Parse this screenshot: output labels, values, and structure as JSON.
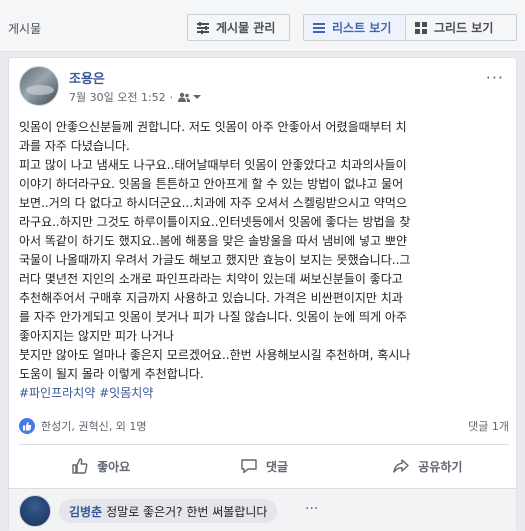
{
  "header": {
    "section_title": "게시물",
    "manage_label": "게시물 관리",
    "list_view_label": "리스트 보기",
    "grid_view_label": "그리드 보기"
  },
  "post": {
    "author": "조용은",
    "timestamp": "7월 30일 오전 1:52",
    "separator": "·",
    "lines": [
      "잇몸이 안좋으신분들께 권합니다. 저도 잇몸이 아주 안좋아서 어렸을때부터 치",
      "과를 자주 다녔습니다.",
      "피고 많이 나고 냄새도 나구요..태어날때부터 잇몸이 안좋았다고 치과의사들이",
      "이야기 하더라구요. 잇몸을 튼튼하고 안아프게 할 수 있는 방법이 없냐고 물어",
      "보면..거의 다 없다고 하시더군요...치과에 자주 오셔서 스켈링받으시고 약먹으",
      "라구요..하지만 그것도 하루이틀이지요..인터넷등에서 잇몸에 좋다는 방법을 찾",
      "아서 똑같이 하기도 했지요..봄에 해풍을 맞은 솔방울을 따서 냄비에 넣고 뽀얀",
      "국물이 나올때까지 우려서 가글도 해보고 했지만 효능이 보지는 못했습니다..그",
      "러다 몇년전 지인의 소개로 파인프라라는 치약이 있는데 써보신분들이 좋다고",
      "추천해주어서 구매후 지금까지 사용하고 있습니다. 가격은 비싼편이지만 치과",
      "를 자주 안가게되고 잇몸이 붓거나 피가 나질 않습니다. 잇몸이 눈에 띄게 아주",
      "좋아지지는 않지만 피가 나거나",
      "붓지만 않아도 얼마나 좋은지 모르겠어요..한번 사용해보시길 추천하며, 혹시나",
      "도움이 될지 몰라 이렇게 추천합니다."
    ],
    "hashtags": "#파인프라치약 #잇몸치약",
    "reactions_text": "한성기, 권혁신, 외 1명",
    "comment_count": "댓글 1개",
    "like_label": "좋아요",
    "comment_label": "댓글",
    "share_label": "공유하기",
    "more_icon": "···",
    "like_color": "#4a78e6"
  },
  "comment": {
    "author": "김병춘",
    "text": "정말로 좋은거? 한번 써볼랍니다",
    "more_icon": "···"
  }
}
